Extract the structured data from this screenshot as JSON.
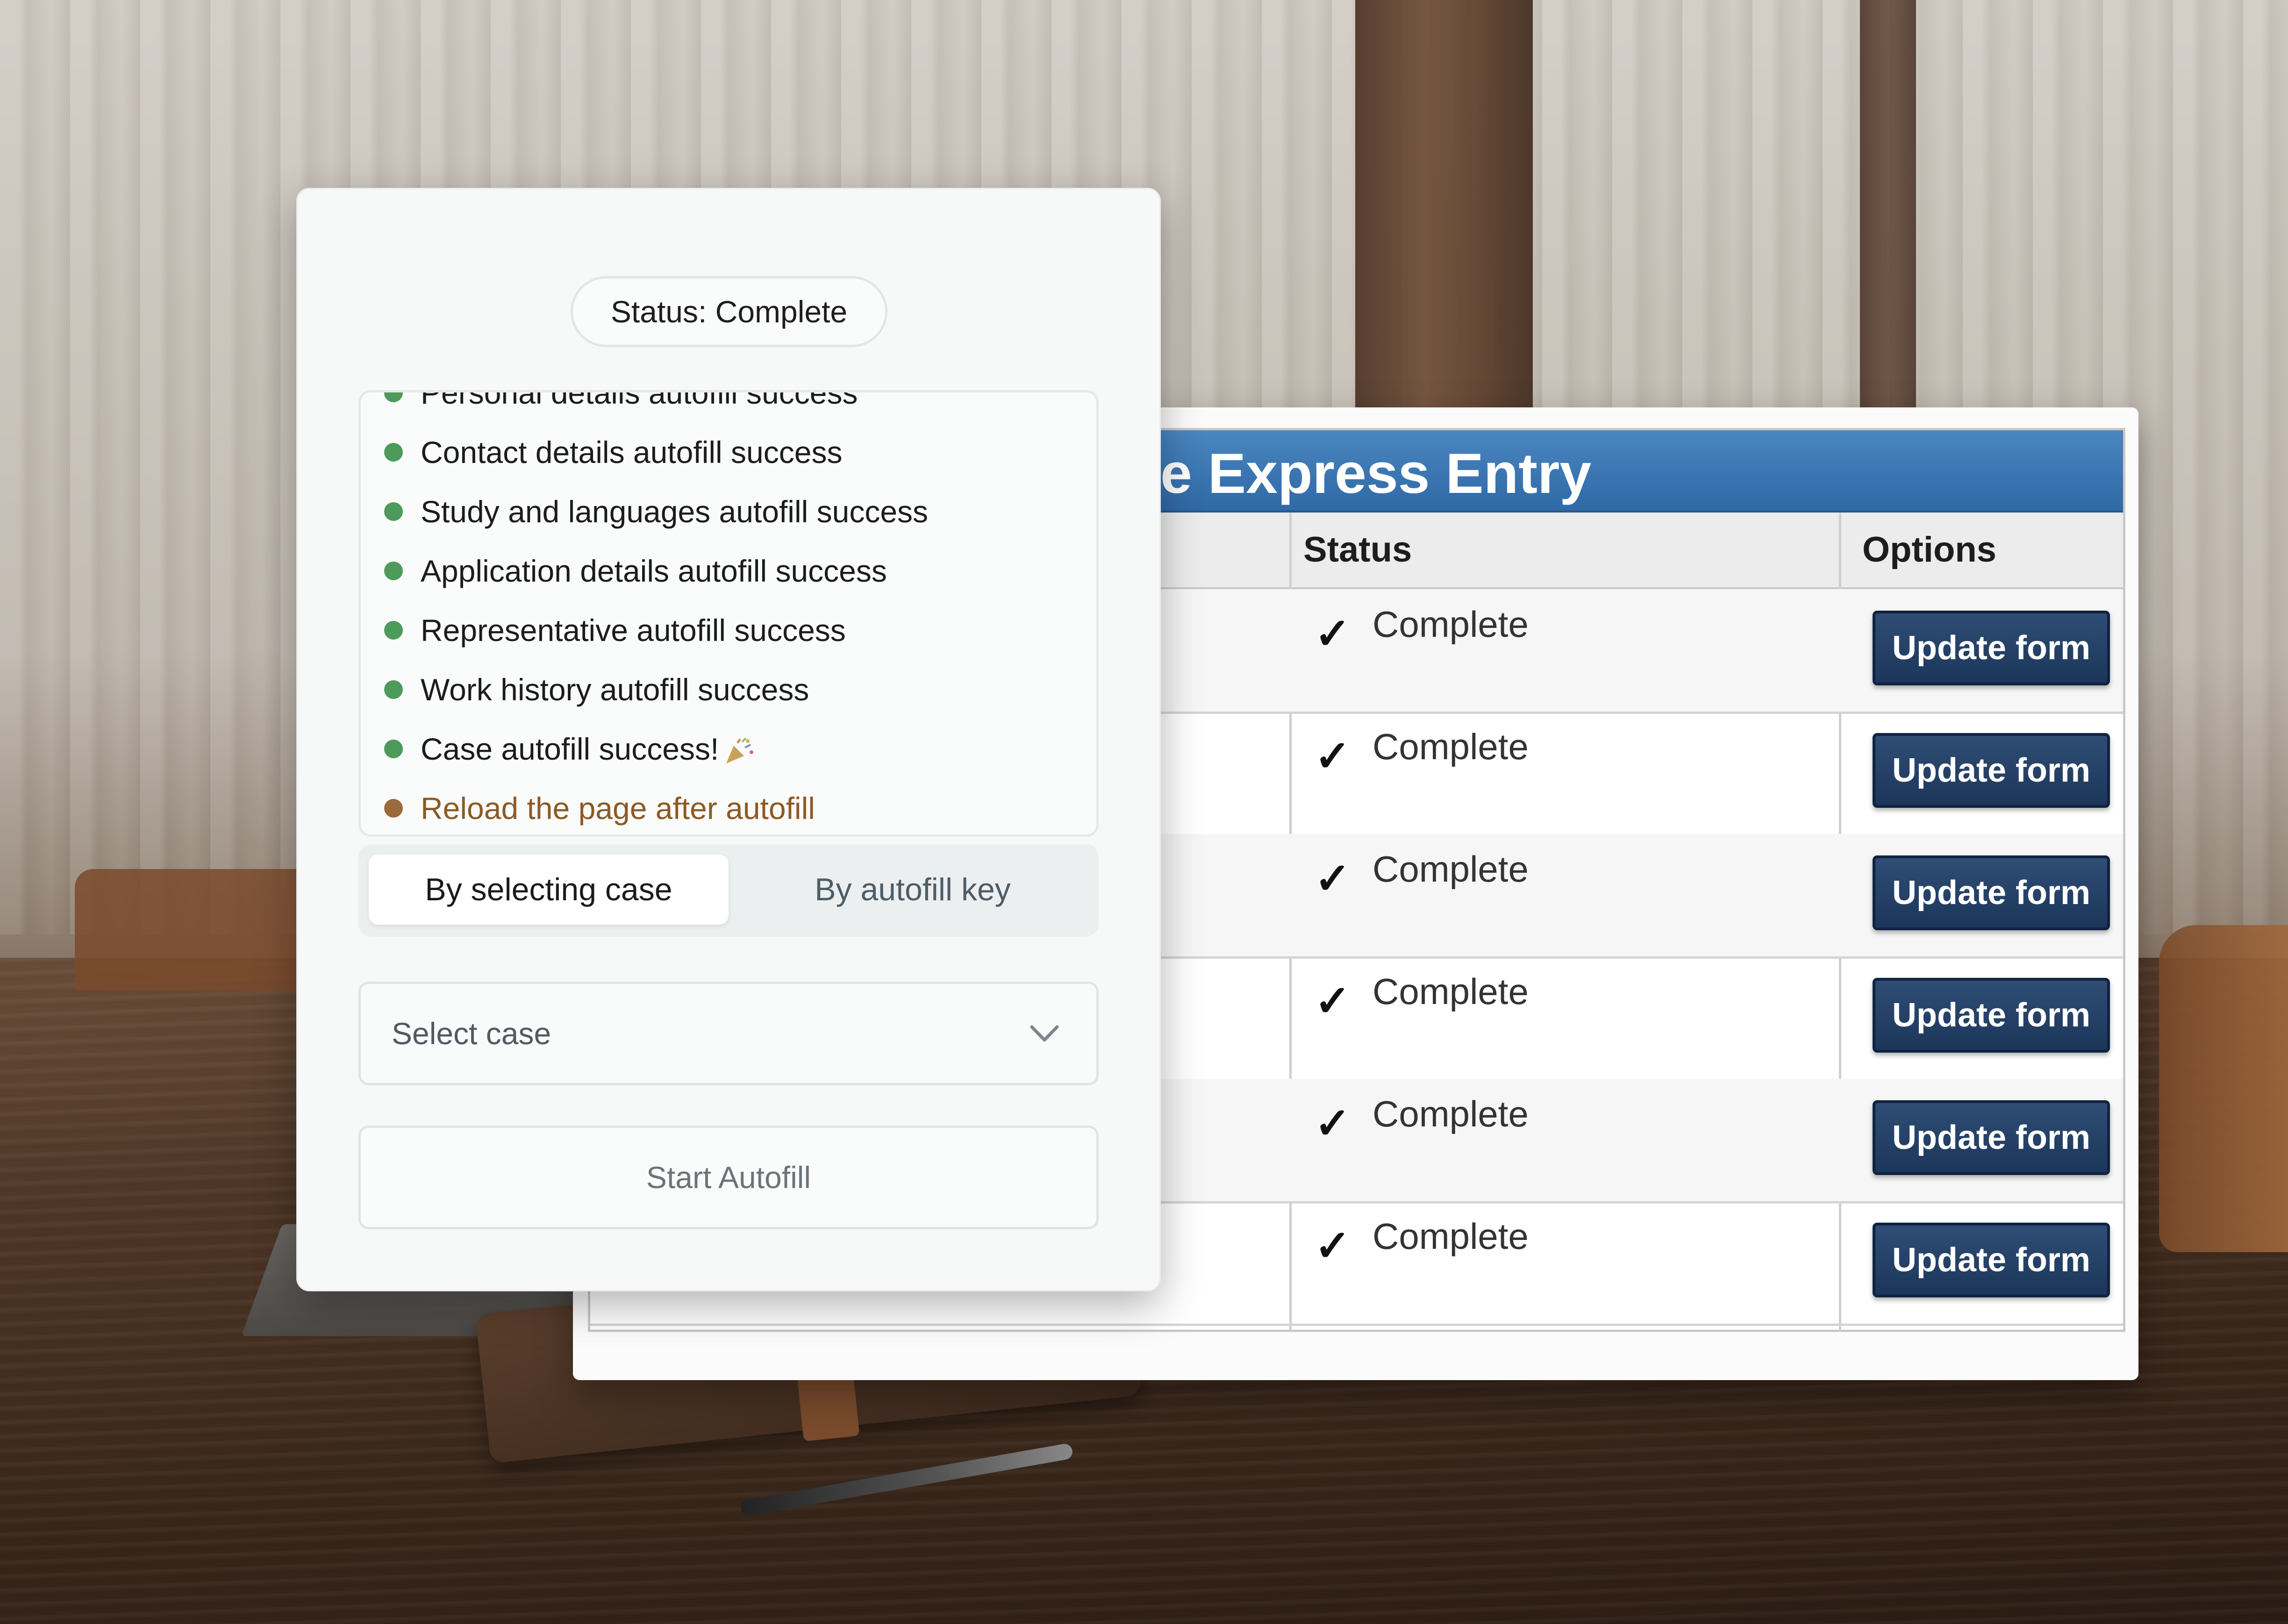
{
  "table": {
    "title": "e Express Entry",
    "columns": {
      "status": "Status",
      "options": "Options"
    },
    "rows": [
      {
        "check": "✓",
        "status": "Complete",
        "button": "Update form"
      },
      {
        "check": "✓",
        "status": "Complete",
        "button": "Update form"
      },
      {
        "check": "✓",
        "status": "Complete",
        "button": "Update form"
      },
      {
        "check": "✓",
        "status": "Complete",
        "button": "Update form"
      },
      {
        "check": "✓",
        "status": "Complete",
        "button": "Update form"
      },
      {
        "check": "✓",
        "status": "Complete",
        "button": "Update form"
      }
    ],
    "colors": {
      "title_bar": "#2f69a6",
      "button": "#1c365a"
    }
  },
  "panel": {
    "status_label": "Status: Complete",
    "log": [
      {
        "text": "Personal details autofill success",
        "state": "success"
      },
      {
        "text": "Contact details autofill success",
        "state": "success"
      },
      {
        "text": "Study and languages autofill success",
        "state": "success"
      },
      {
        "text": "Application details autofill success",
        "state": "success"
      },
      {
        "text": "Representative autofill success",
        "state": "success"
      },
      {
        "text": "Work history autofill success",
        "state": "success"
      },
      {
        "text": "Case autofill success!",
        "state": "success",
        "icon": "party-popper-icon"
      },
      {
        "text": "Reload the page after autofill",
        "state": "warning"
      }
    ],
    "tabs": {
      "active": "By selecting case",
      "inactive": "By autofill key"
    },
    "select": {
      "placeholder": "Select case",
      "icon": "chevron-down-icon"
    },
    "start_button": "Start Autofill",
    "colors": {
      "success_dot": "#4d9a5b",
      "warning_dot": "#9b6a3c",
      "warning_text": "#8c5a24"
    }
  }
}
